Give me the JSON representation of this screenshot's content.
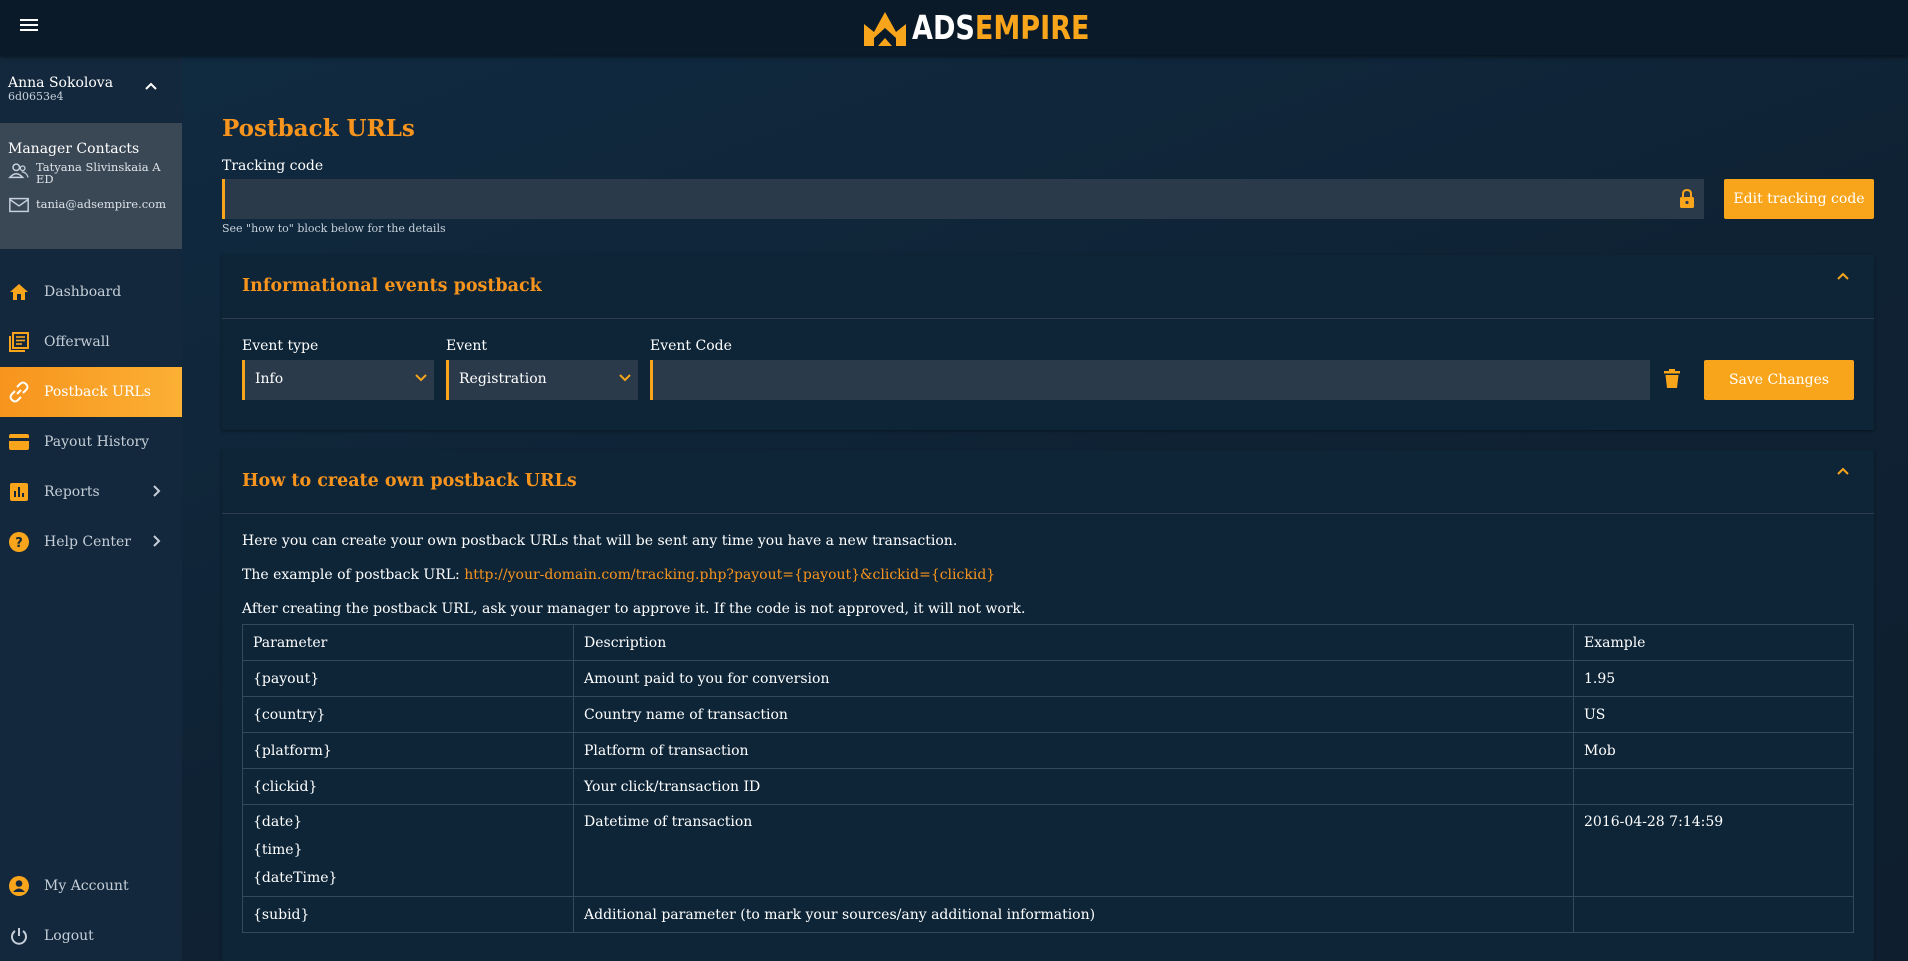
{
  "brand": {
    "part1": "ADS",
    "part2": "EMPIRE",
    "accent": "#f8a51c"
  },
  "user": {
    "name": "Anna Sokolova",
    "id": "6d0653e4"
  },
  "manager": {
    "title": "Manager Contacts",
    "name": "Tatyana Slivinskaia A ED",
    "email": "tania@adsempire.com"
  },
  "nav": {
    "items": [
      {
        "label": "Dashboard",
        "icon": "home-icon"
      },
      {
        "label": "Offerwall",
        "icon": "offerwall-icon"
      },
      {
        "label": "Postback URLs",
        "icon": "link-icon",
        "active": true
      },
      {
        "label": "Payout History",
        "icon": "credit-card-icon"
      },
      {
        "label": "Reports",
        "icon": "bar-chart-icon"
      },
      {
        "label": "Help Center",
        "icon": "help-icon"
      }
    ],
    "bottom": [
      {
        "label": "My Account",
        "icon": "account-icon"
      },
      {
        "label": "Logout",
        "icon": "power-icon"
      }
    ]
  },
  "page": {
    "title": "Postback URLs",
    "tracking": {
      "label": "Tracking code",
      "value": "",
      "hint": "See \"how to\" block below for the details",
      "edit_label": "Edit tracking code"
    }
  },
  "events_panel": {
    "title": "Informational events postback",
    "event_type_label": "Event type",
    "event_type_value": "Info",
    "event_label": "Event",
    "event_value": "Registration",
    "code_label": "Event Code",
    "code_value": "",
    "save_label": "Save Changes"
  },
  "howto": {
    "title": "How to create own postback URLs",
    "p1": "Here you can create your own postback URLs that will be sent any time you have a new transaction.",
    "p2_prefix": "The example of postback URL:",
    "p2_link": "http://your-domain.com/tracking.php?payout={payout}&clickid={clickid}",
    "p3": "After creating the postback URL, ask your manager to approve it. If the code is not approved, it will not work.",
    "headers": [
      "Parameter",
      "Description",
      "Example"
    ],
    "rows": [
      {
        "param": "{payout}",
        "desc": "Amount paid to you for conversion",
        "example": "1.95"
      },
      {
        "param": "{country}",
        "desc": "Country name of transaction",
        "example": "US"
      },
      {
        "param": "{platform}",
        "desc": "Platform of transaction",
        "example": "Mob"
      },
      {
        "param": "{clickid}",
        "desc": "Your click/transaction ID",
        "example": ""
      },
      {
        "param_lines": [
          "{date}",
          "{time}",
          "{dateTime}"
        ],
        "desc": "Datetime of transaction",
        "example": "2016-04-28 7:14:59"
      },
      {
        "param": "{subid}",
        "desc": "Additional parameter (to mark your sources/any additional information)",
        "example": ""
      }
    ]
  }
}
